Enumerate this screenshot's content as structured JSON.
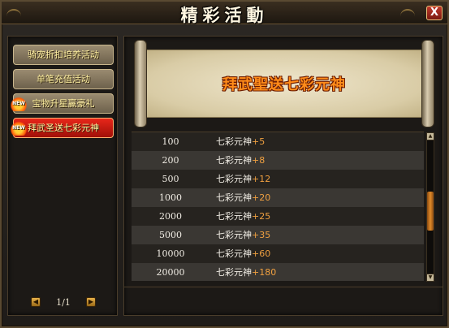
{
  "window": {
    "title": "精彩活動",
    "close_label": "X"
  },
  "sidebar": {
    "items": [
      {
        "label": "骑宠折扣培养活动",
        "new": false,
        "active": false
      },
      {
        "label": "单笔充值活动",
        "new": false,
        "active": false
      },
      {
        "label": "宝物升星赢豪礼",
        "new": true,
        "active": false
      },
      {
        "label": "拜武圣送七彩元神",
        "new": true,
        "active": true
      }
    ],
    "new_badge": "NEW",
    "pager": {
      "prev": "◀",
      "next": "▶",
      "text": "1/1"
    }
  },
  "banner": {
    "title": "拜武聖送七彩元神"
  },
  "rewards": [
    {
      "amount": "100",
      "item": "七彩元神",
      "bonus": "+5"
    },
    {
      "amount": "200",
      "item": "七彩元神",
      "bonus": "+8"
    },
    {
      "amount": "500",
      "item": "七彩元神",
      "bonus": "+12"
    },
    {
      "amount": "1000",
      "item": "七彩元神",
      "bonus": "+20"
    },
    {
      "amount": "2000",
      "item": "七彩元神",
      "bonus": "+25"
    },
    {
      "amount": "5000",
      "item": "七彩元神",
      "bonus": "+35"
    },
    {
      "amount": "10000",
      "item": "七彩元神",
      "bonus": "+60"
    },
    {
      "amount": "20000",
      "item": "七彩元神",
      "bonus": "+180"
    }
  ],
  "scrollbar": {
    "up": "▲",
    "down": "▼"
  },
  "colors": {
    "accent_orange": "#f0a040",
    "active_red": "#e8261a",
    "gold": "#e7b14a"
  }
}
